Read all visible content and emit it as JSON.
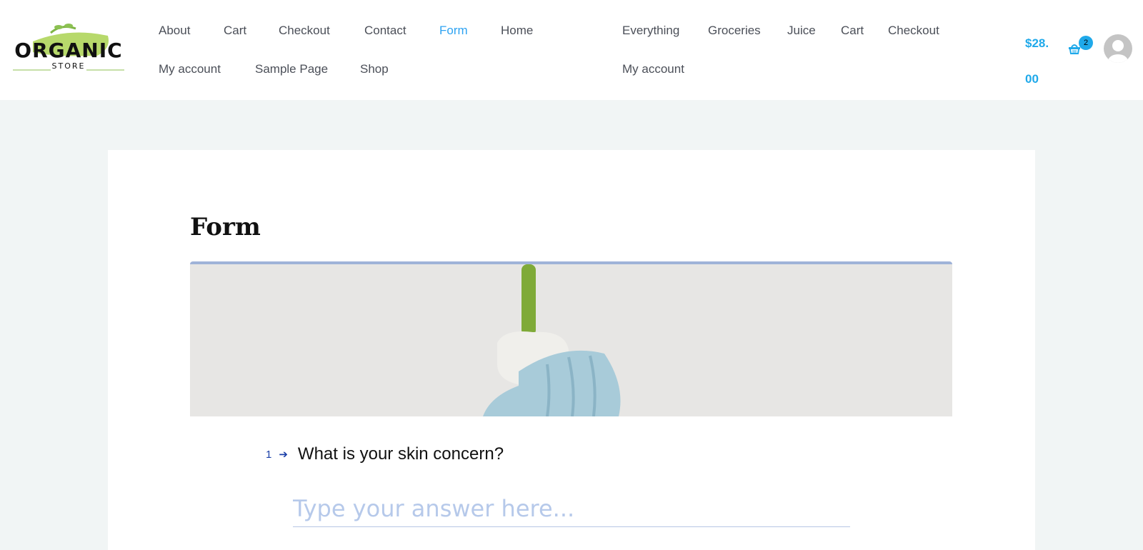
{
  "header": {
    "logo": {
      "word": "ORGANIC",
      "sub": "STORE"
    },
    "nav_primary": [
      {
        "label": "About"
      },
      {
        "label": "Cart"
      },
      {
        "label": "Checkout"
      },
      {
        "label": "Contact"
      },
      {
        "label": "Form",
        "active": true
      },
      {
        "label": "Home"
      },
      {
        "label": "My account"
      },
      {
        "label": "Sample Page"
      },
      {
        "label": "Shop"
      }
    ],
    "nav_secondary": [
      {
        "label": "Everything"
      },
      {
        "label": "Groceries"
      },
      {
        "label": "Juice"
      },
      {
        "label": "Cart"
      },
      {
        "label": "Checkout"
      },
      {
        "label": "My account"
      }
    ],
    "cart_total": "$28.00",
    "cart_count": "2",
    "cart_icon": "basket-icon",
    "accent": "#2ea3f2"
  },
  "page": {
    "title": "Form",
    "question_number": "1",
    "question": "What is your skin concern?",
    "answer_placeholder": "Type your answer here...",
    "answer_value": ""
  }
}
